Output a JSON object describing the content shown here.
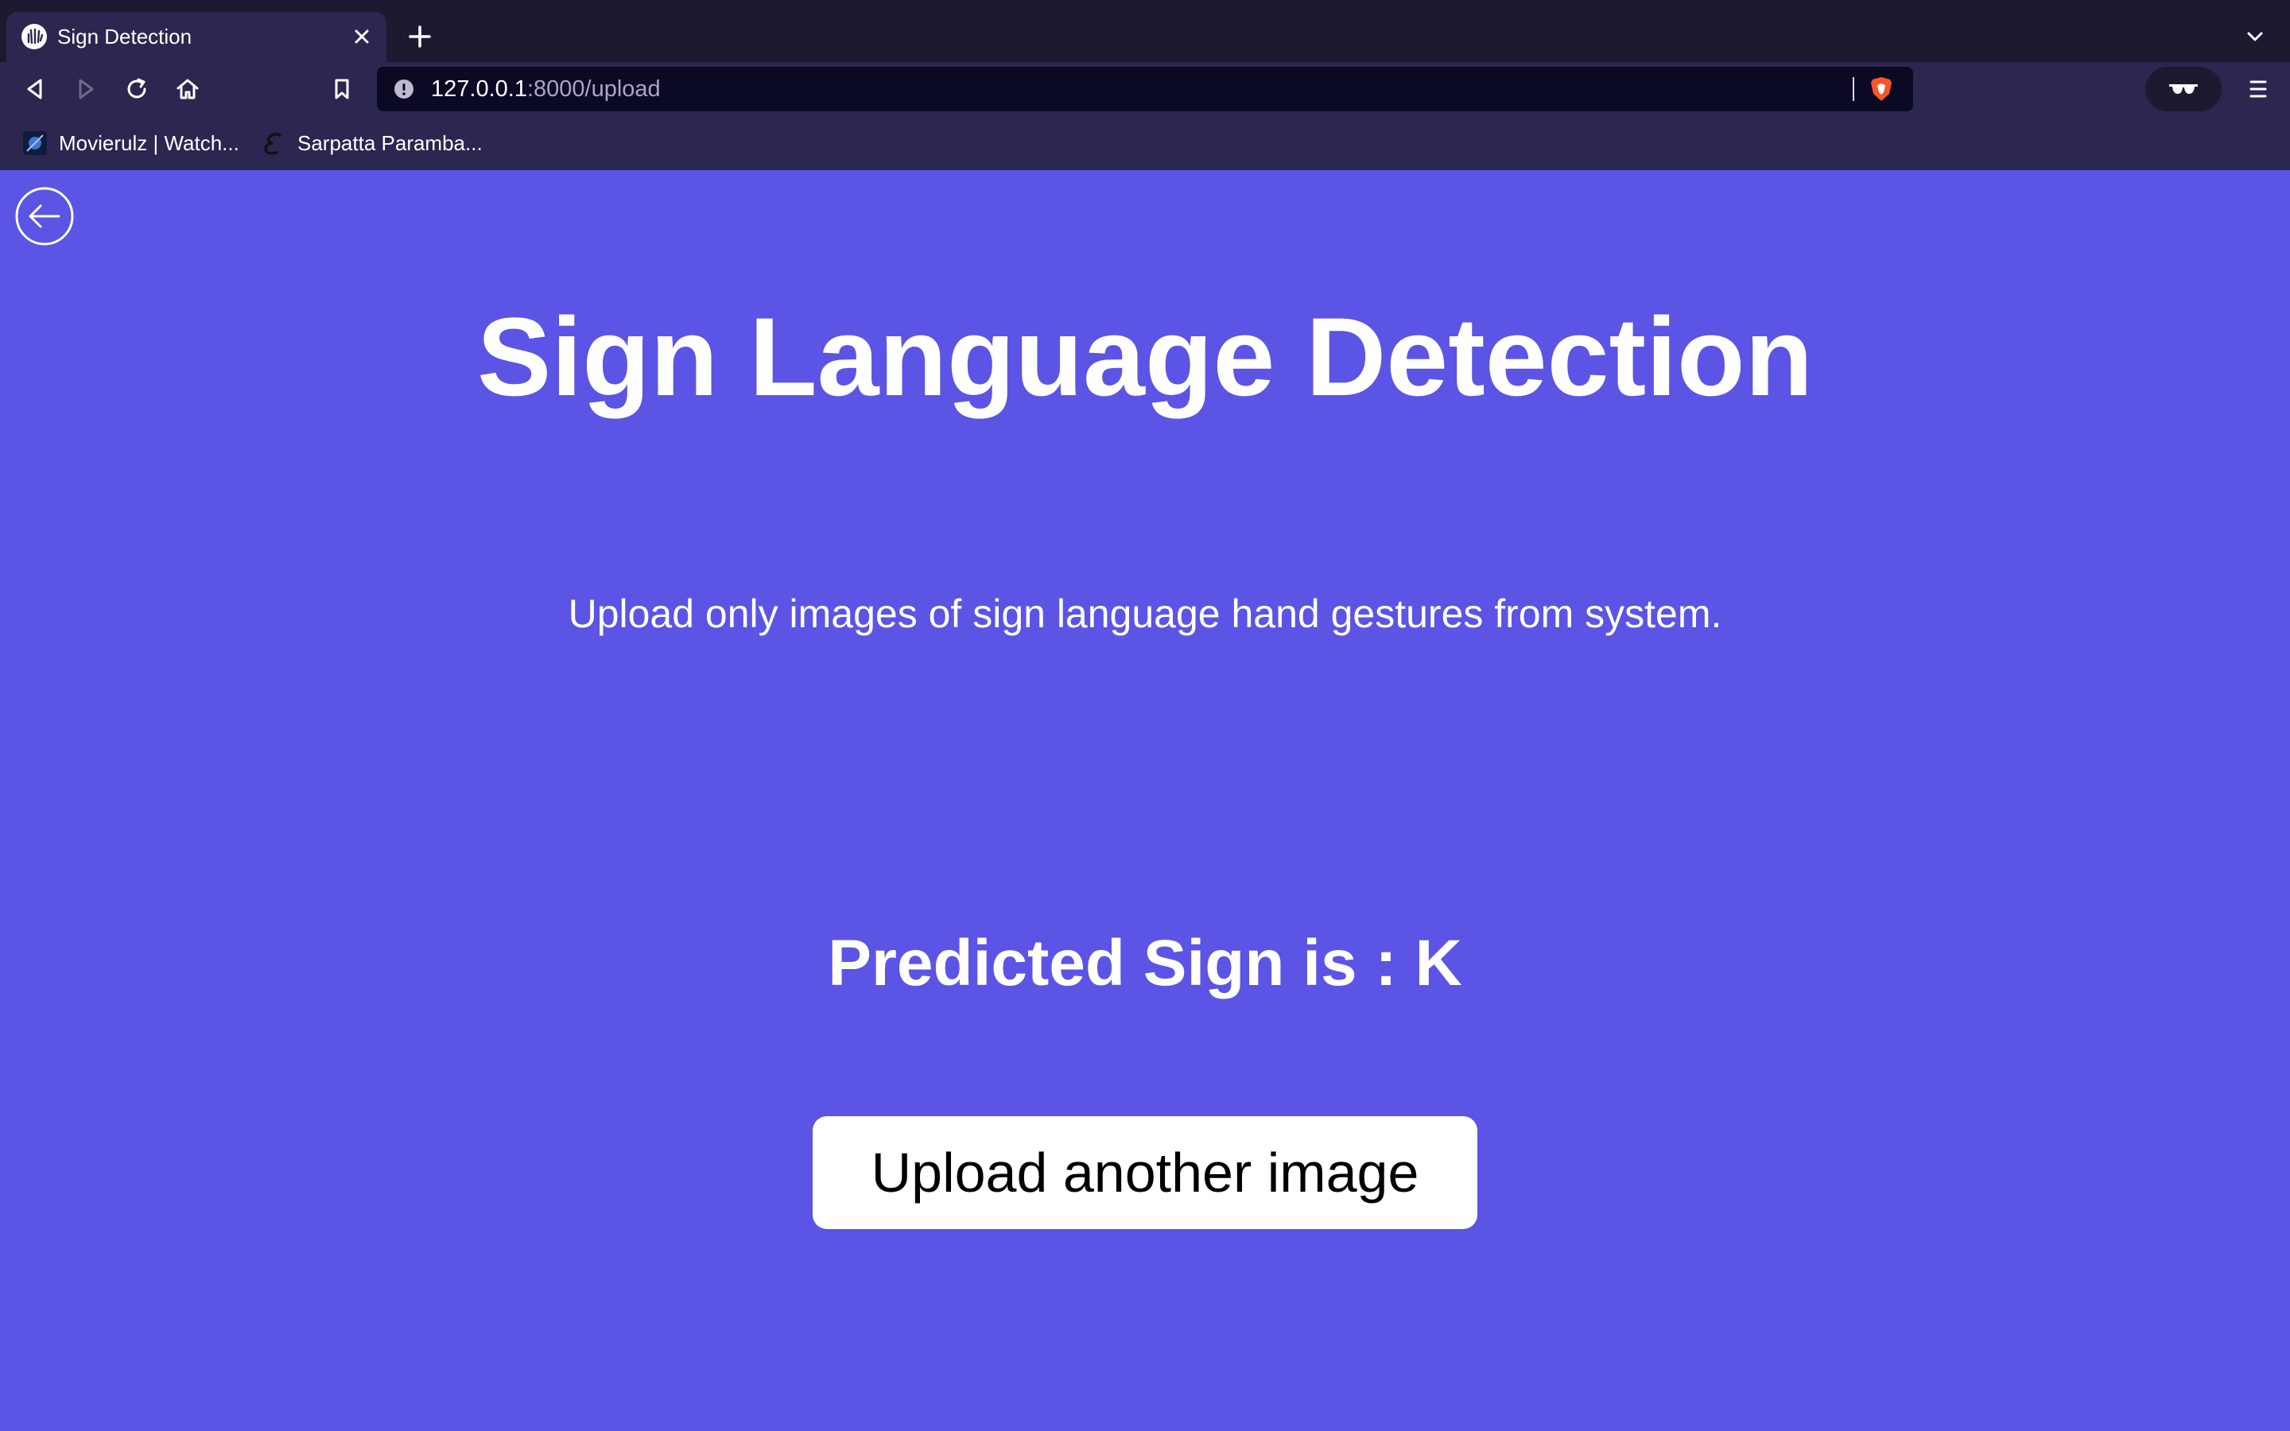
{
  "browser": {
    "tab": {
      "title": "Sign Detection",
      "favicon": "hand-gesture-icon"
    },
    "url": {
      "host": "127.0.0.1",
      "path": ":8000/upload"
    },
    "bookmarks": [
      {
        "label": "Movierulz | Watch...",
        "icon": "movierulz-favicon"
      },
      {
        "label": "Sarpatta Paramba...",
        "icon": "script-e-favicon"
      }
    ],
    "colors": {
      "tab_strip": "#1c1a31",
      "toolbar": "#2b2750",
      "url_field": "#0b0a24",
      "shield": "#fb542b"
    }
  },
  "page": {
    "title": "Sign Language Detection",
    "subtitle": "Upload only images of sign language hand gestures from system.",
    "result_label": "Predicted Sign is : K",
    "upload_button_label": "Upload another image",
    "colors": {
      "background": "#5c54e4",
      "text": "#ffffff",
      "button_bg": "#ffffff",
      "button_text": "#000000"
    }
  }
}
